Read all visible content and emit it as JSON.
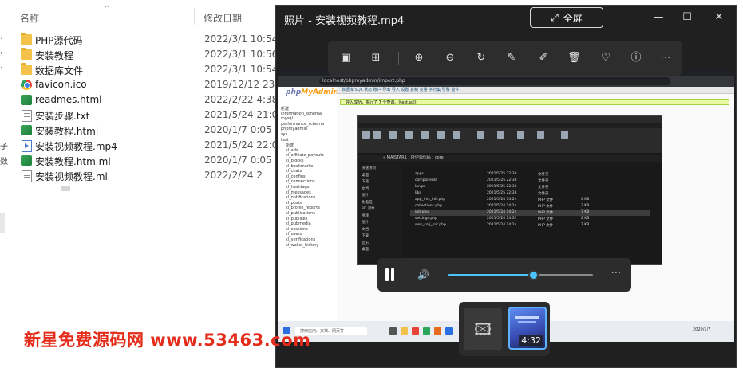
{
  "explorer": {
    "columns": {
      "name": "名称",
      "modified": "修改日期"
    },
    "files": [
      {
        "name": "PHP源代码",
        "date": "2022/3/1 10:54",
        "icon": "folder-icon"
      },
      {
        "name": "安装教程",
        "date": "2022/3/1 10:56",
        "icon": "folder-icon"
      },
      {
        "name": "数据库文件",
        "date": "2022/3/1 10:54",
        "icon": "folder-icon"
      },
      {
        "name": "favicon.ico",
        "date": "2019/12/12 23:38",
        "icon": "chrome-icon"
      },
      {
        "name": "readmes.html",
        "date": "2022/2/22 4:38",
        "icon": "html-file-icon"
      },
      {
        "name": "安装步骤.txt",
        "date": "2021/5/24 21:03",
        "icon": "text-file-icon"
      },
      {
        "name": "安装教程.html",
        "date": "2020/1/7 0:05",
        "icon": "html-file-icon"
      },
      {
        "name": "安装视频教程.mp4",
        "date": "2021/5/24 22:04",
        "icon": "video-file-icon"
      },
      {
        "name": "安装教程.htm ml",
        "date": "2020/1/7 0:05",
        "icon": "html-file-icon"
      },
      {
        "name": "安装视频教程.ml",
        "date": "2022/2/24 2",
        "icon": "text-file-icon"
      }
    ],
    "left_fragments": [
      "子",
      "数"
    ]
  },
  "player": {
    "title": "照片 - 安装视频教程.mp4",
    "fullscreen_label": "全屏",
    "seek_progress": 0.59,
    "duration": "4:32",
    "frame": {
      "address": "localhost/phpmyadmin/import.php",
      "pma_logo_a": "php",
      "pma_logo_b": "MyAdmin",
      "pma_tabs": "数据库   SQL   状态   账户   导出   导入   设置   复制   变量   字符集   引擎   插件",
      "pma_ok": "导入成功，执行了 7 个查询。(test.sql)",
      "pma_tree": [
        "新建",
        "information_schema",
        "mysql",
        "performance_schema",
        "phpmyadmin",
        "sys",
        "test",
        "新建",
        "cl_ads",
        "cl_affiliate_payouts",
        "cl_blocks",
        "cl_bookmarks",
        "cl_chats",
        "cl_configs",
        "cl_connections",
        "cl_hashtags",
        "cl_messages",
        "cl_notifications",
        "cl_posts",
        "cl_profile_reports",
        "cl_publications",
        "cl_publikes",
        "cl_pubmedia",
        "cl_sessions",
        "cl_users",
        "cl_verifications",
        "cl_wallet_history"
      ],
      "inner_path": "« MAISTAR1 › PHP源代码 › core",
      "inner_nav": [
        "快速访问",
        "桌面",
        "下载",
        "文档",
        "图片",
        "此电脑",
        "3D 对象",
        "视频",
        "图片",
        "文档",
        "下载",
        "音乐",
        "桌面"
      ],
      "inner_files": [
        {
          "name": "apps",
          "date": "2021/5/25 22:38",
          "type": "文件夹",
          "size": ""
        },
        {
          "name": "components",
          "date": "2021/5/25 22:38",
          "type": "文件夹",
          "size": ""
        },
        {
          "name": "langs",
          "date": "2021/5/25 22:38",
          "type": "文件夹",
          "size": ""
        },
        {
          "name": "libs",
          "date": "2021/5/25 22:38",
          "type": "文件夹",
          "size": ""
        },
        {
          "name": "app_ims_init.php",
          "date": "2021/5/24 14:24",
          "type": "PHP 文件",
          "size": "4 KB"
        },
        {
          "name": "collections.php",
          "date": "2021/5/24 14:24",
          "type": "PHP 文件",
          "size": "2 KB"
        },
        {
          "name": "init.php",
          "date": "2021/5/24 14:24",
          "type": "PHP 文件",
          "size": "7 KB"
        },
        {
          "name": "settings.php",
          "date": "2021/5/24 14:31",
          "type": "PHP 文件",
          "size": "2 KB"
        },
        {
          "name": "web_csrj_init.php",
          "date": "2021/5/24 14:24",
          "type": "PHP 文件",
          "size": "7 KB"
        }
      ],
      "taskbar_search": "搜索应用、文档、网页等",
      "taskbar_time": "2020/1/7"
    }
  },
  "watermark": "新星免费源码网  www.53463.com",
  "colors": {
    "accent": "#4cc2ff",
    "watermark": "#e52b19",
    "player_bg": "#202020"
  }
}
